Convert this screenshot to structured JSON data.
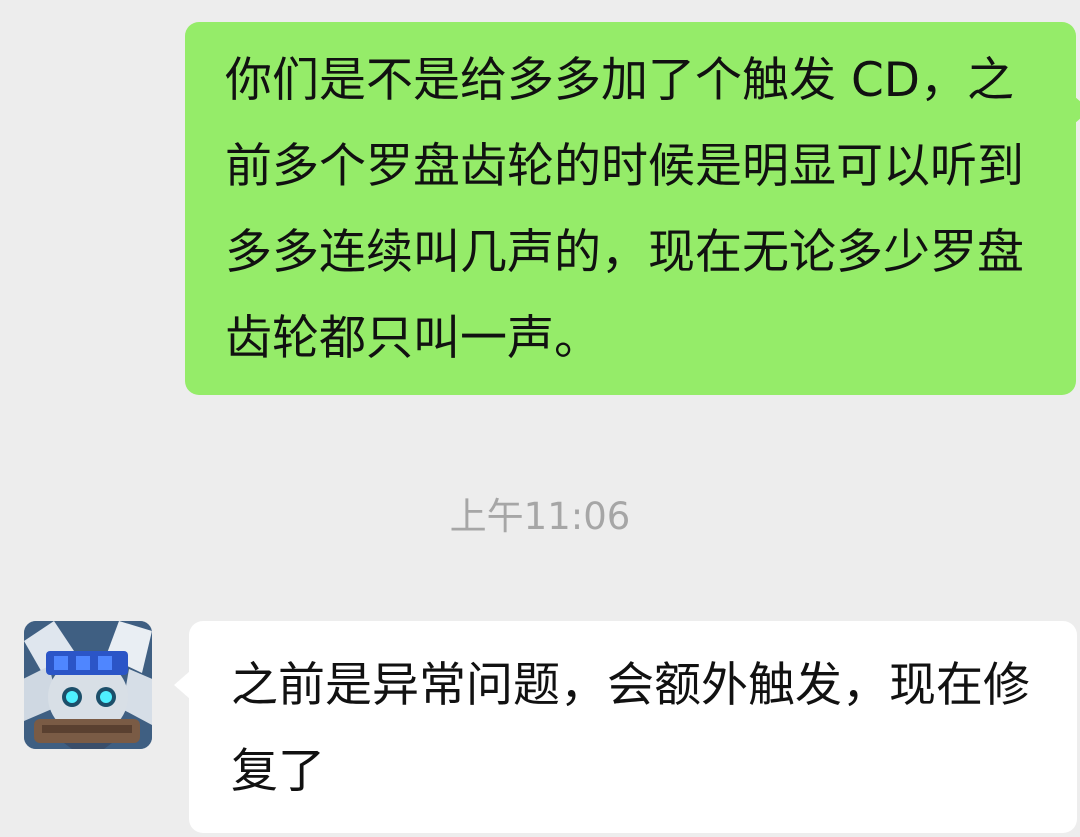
{
  "messages": {
    "outgoing": {
      "text": "你们是不是给多多加了个触发 CD，之前多个罗盘齿轮的时候是明显可以听到多多连续叫几声的，现在无论多少罗盘齿轮都只叫一声。"
    },
    "timestamp": "上午11:06",
    "incoming": {
      "text": "之前是异常问题，会额外触发，现在修复了",
      "avatar_icon": "game-character-avatar"
    }
  },
  "colors": {
    "background": "#ededed",
    "outgoing_bubble": "#95ec69",
    "incoming_bubble": "#ffffff",
    "timestamp_text": "#a6a6a6",
    "message_text": "#111111"
  }
}
